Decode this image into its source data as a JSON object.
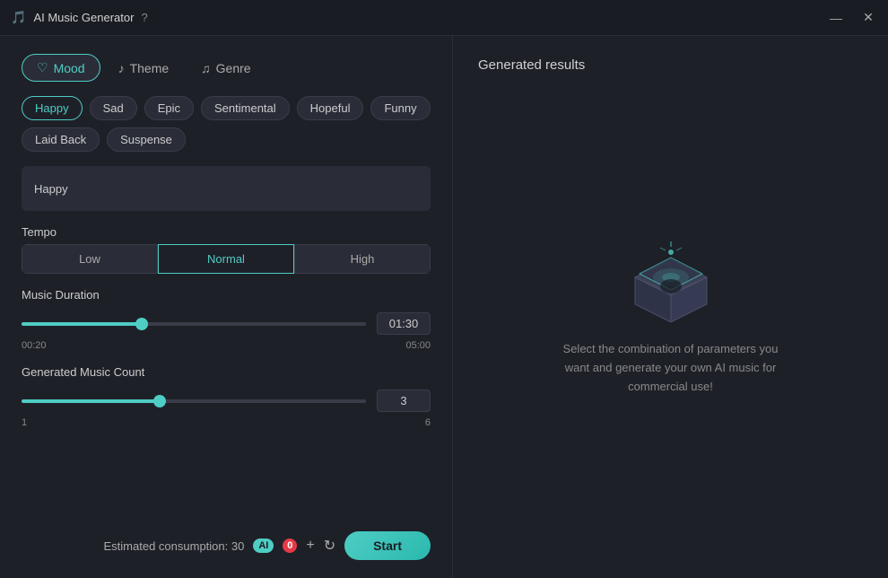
{
  "titleBar": {
    "title": "AI Music Generator",
    "helpIcon": "?",
    "minimizeIcon": "—",
    "closeIcon": "✕"
  },
  "tabs": [
    {
      "id": "mood",
      "label": "Mood",
      "icon": "♡",
      "active": true
    },
    {
      "id": "theme",
      "label": "Theme",
      "icon": "♪",
      "active": false
    },
    {
      "id": "genre",
      "label": "Genre",
      "icon": "♫",
      "active": false
    }
  ],
  "moodChips": [
    {
      "label": "Happy",
      "selected": true
    },
    {
      "label": "Sad",
      "selected": false
    },
    {
      "label": "Epic",
      "selected": false
    },
    {
      "label": "Sentimental",
      "selected": false
    },
    {
      "label": "Hopeful",
      "selected": false
    },
    {
      "label": "Funny",
      "selected": false
    },
    {
      "label": "Laid Back",
      "selected": false
    },
    {
      "label": "Suspense",
      "selected": false
    }
  ],
  "moodTextValue": "Happy",
  "tempo": {
    "label": "Tempo",
    "options": [
      {
        "label": "Low",
        "active": false
      },
      {
        "label": "Normal",
        "active": true
      },
      {
        "label": "High",
        "active": false
      }
    ]
  },
  "musicDuration": {
    "label": "Music Duration",
    "min": "00:20",
    "max": "05:00",
    "value": "01:30",
    "fillPercent": 35,
    "thumbPercent": 35
  },
  "musicCount": {
    "label": "Generated Music Count",
    "min": "1",
    "max": "6",
    "value": "3",
    "fillPercent": 40,
    "thumbPercent": 40
  },
  "bottomBar": {
    "consumptionLabel": "Estimated consumption:",
    "consumptionValue": "30",
    "aiBadge": "AI",
    "countBadge": "0",
    "addIcon": "+",
    "refreshIcon": "↻",
    "startLabel": "Start"
  },
  "rightPanel": {
    "title": "Generated results",
    "emptyText": "Select the combination of parameters you want and generate your own AI music for commercial use!"
  }
}
